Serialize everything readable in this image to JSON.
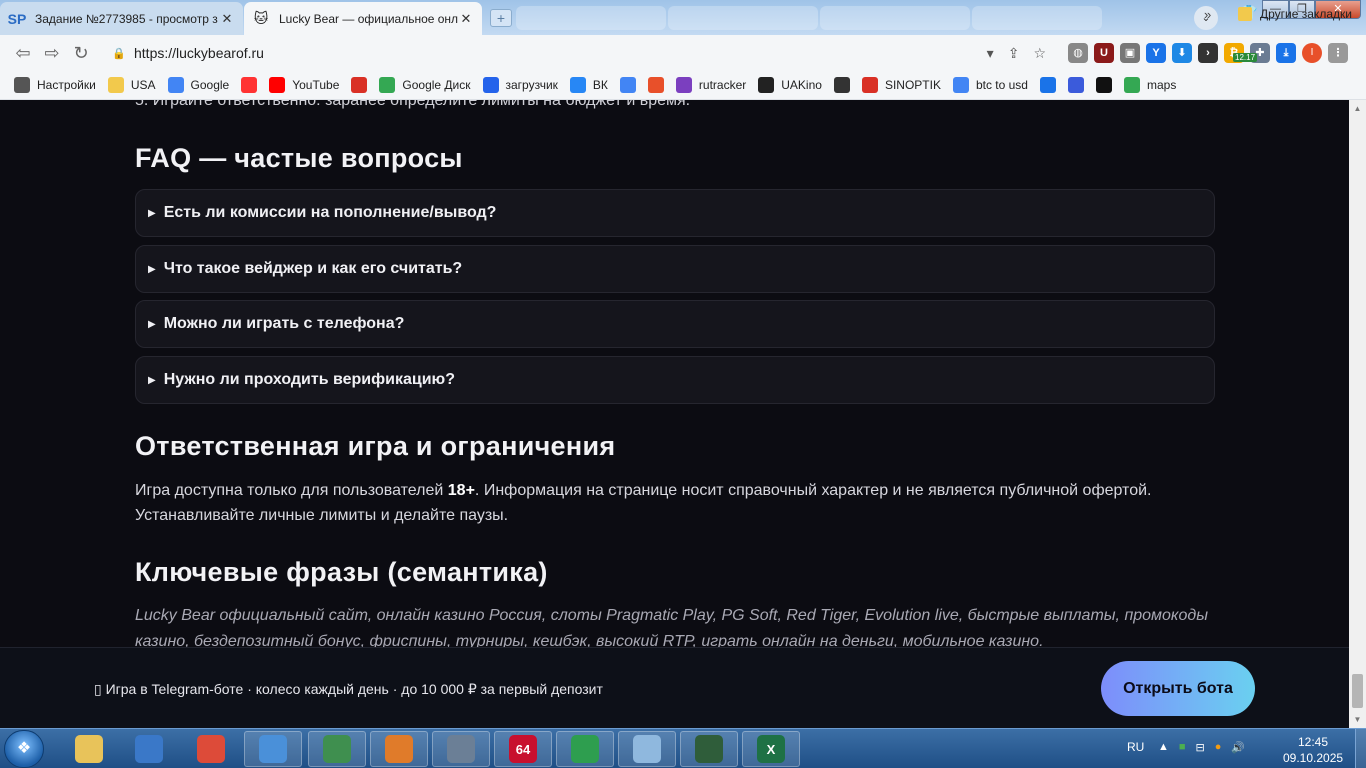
{
  "browser": {
    "tabs": [
      {
        "favicon": "SP",
        "title": "Задание №2773985 - просмотр з"
      },
      {
        "favicon": "🐱",
        "title": "Lucky Bear — официальное онла"
      }
    ],
    "new_tab": "+",
    "tab_search_icon": "⌄",
    "window": {
      "minimize": "—",
      "maximize": "❐",
      "close": "✕"
    },
    "address": {
      "url": "https://luckybearof.ru",
      "lock_icon": "lock-icon"
    },
    "profile_initial": "I",
    "ext_badge": "12.17"
  },
  "bookmarks": {
    "items": [
      {
        "label": "Настройки",
        "icon": "gear-icon",
        "color": "#555555"
      },
      {
        "label": "USA",
        "icon": "folder-icon",
        "color": "#f2c94c"
      },
      {
        "label": "Google",
        "icon": "google-icon",
        "color": "#4285f4"
      },
      {
        "label": "",
        "icon": "yandex-icon",
        "color": "#ff3333"
      },
      {
        "label": "YouTube",
        "icon": "youtube-icon",
        "color": "#ff0000"
      },
      {
        "label": "",
        "icon": "gmail-icon",
        "color": "#d93025"
      },
      {
        "label": "Google Диск",
        "icon": "drive-icon",
        "color": "#34a853"
      },
      {
        "label": "загрузчик",
        "icon": "infinity-icon",
        "color": "#2463eb"
      },
      {
        "label": "ВК",
        "icon": "vk-icon",
        "color": "#2787f5"
      },
      {
        "label": "",
        "icon": "translate-icon",
        "color": "#4285f4"
      },
      {
        "label": "",
        "icon": "f-icon",
        "color": "#e8502a"
      },
      {
        "label": "rutracker",
        "icon": "star-icon",
        "color": "#7b3fbf"
      },
      {
        "label": "UAKino",
        "icon": "film-icon",
        "color": "#222222"
      },
      {
        "label": "",
        "icon": "figure-icon",
        "color": "#333333"
      },
      {
        "label": "SINOPTIK",
        "icon": "thermometer-icon",
        "color": "#d93025"
      },
      {
        "label": "btc to usd",
        "icon": "google-icon",
        "color": "#4285f4"
      },
      {
        "label": "",
        "icon": "p-icon",
        "color": "#1a73e8"
      },
      {
        "label": "",
        "icon": "arrow-icon",
        "color": "#3b5bdb"
      },
      {
        "label": "",
        "icon": "bc-icon",
        "color": "#111111"
      },
      {
        "label": "maps",
        "icon": "maps-icon",
        "color": "#34a853"
      }
    ],
    "more": "»",
    "other": "Другие закладки"
  },
  "page": {
    "cut_line": "5. Играйте ответственно: заранее определите лимиты на бюджет и время.",
    "faq_title": "FAQ — частые вопросы",
    "faq": [
      "Есть ли комиссии на пополнение/вывод?",
      "Что такое вейджер и как его считать?",
      "Можно ли играть с телефона?",
      "Нужно ли проходить верификацию?"
    ],
    "responsible_title": "Ответственная игра и ограничения",
    "responsible_text_a": "Игра доступна только для пользователей ",
    "responsible_text_bold": "18+",
    "responsible_text_b": ". Информация на странице носит справочный характер и не является публичной офертой.",
    "responsible_text_c": "Устанавливайте личные лимиты и делайте паузы.",
    "keywords_title": "Ключевые фразы (семантика)",
    "keywords_text": "Lucky Bear официальный сайт, онлайн казино Россия, слоты Pragmatic Play, PG Soft, Red Tiger, Evolution live, быстрые выплаты, промокоды казино, бездепозитный бонус, фриспины, турниры, кешбэк, высокий RTP, играть онлайн на деньги, мобильное казино.",
    "promo_text": "▯ Игра в Telegram-боте · колесо каждый день · до 10 000 ₽ за первый депозит",
    "promo_button": "Открыть бота"
  },
  "taskbar": {
    "language": "RU",
    "time": "12:45",
    "date": "09.10.2025",
    "apps": [
      {
        "name": "explorer",
        "label": "",
        "color": "#e8c35a"
      },
      {
        "name": "shield",
        "label": "",
        "color": "#3a78c8"
      },
      {
        "name": "chrome",
        "label": "",
        "color": "#dd4b39"
      },
      {
        "name": "globe",
        "label": "",
        "color": "#4a90d9"
      },
      {
        "name": "monitor",
        "label": "",
        "color": "#3f8f4f"
      },
      {
        "name": "media",
        "label": "",
        "color": "#e07b2a"
      },
      {
        "name": "clock",
        "label": "",
        "color": "#6b7f96"
      },
      {
        "name": "aida64",
        "label": "64",
        "color": "#c8102e"
      },
      {
        "name": "umbrella",
        "label": "",
        "color": "#2e9e4f"
      },
      {
        "name": "notes",
        "label": "",
        "color": "#8fb8de"
      },
      {
        "name": "terminal",
        "label": "",
        "color": "#2f5d3a"
      },
      {
        "name": "excel",
        "label": "X",
        "color": "#1e7145"
      }
    ]
  }
}
